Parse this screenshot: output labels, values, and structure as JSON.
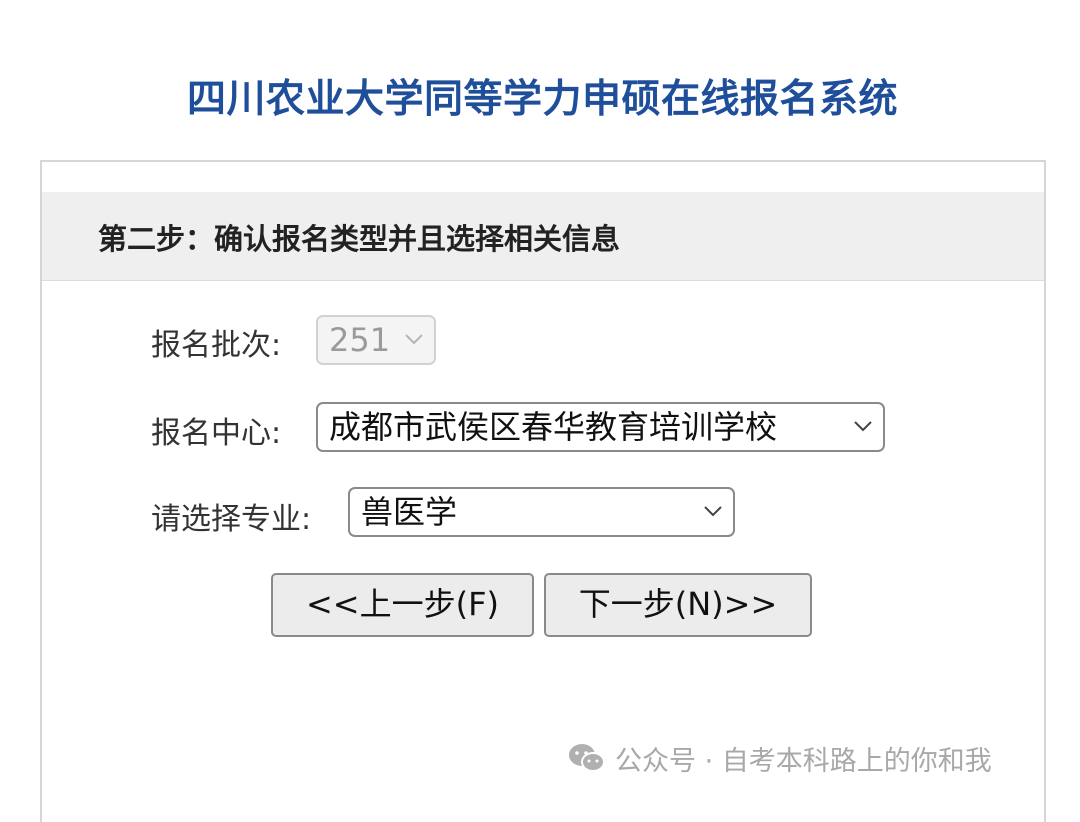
{
  "page": {
    "title": "四川农业大学同等学力申硕在线报名系统"
  },
  "step": {
    "title": "第二步：确认报名类型并且选择相关信息"
  },
  "form": {
    "batch": {
      "label": "报名批次:",
      "value": "251",
      "disabled": true
    },
    "center": {
      "label": "报名中心:",
      "value": "成都市武侯区春华教育培训学校"
    },
    "major": {
      "label": "请选择专业:",
      "value": "兽医学"
    }
  },
  "buttons": {
    "prev_label": "<<上一步(F)",
    "next_label": "下一步(N)>>"
  },
  "watermark": {
    "text": "公众号 · 自考本科路上的你和我",
    "icon": "wechat-icon"
  },
  "colors": {
    "title": "#1f4f9a",
    "header_bg": "#efefef",
    "button_bg": "#ececec"
  }
}
